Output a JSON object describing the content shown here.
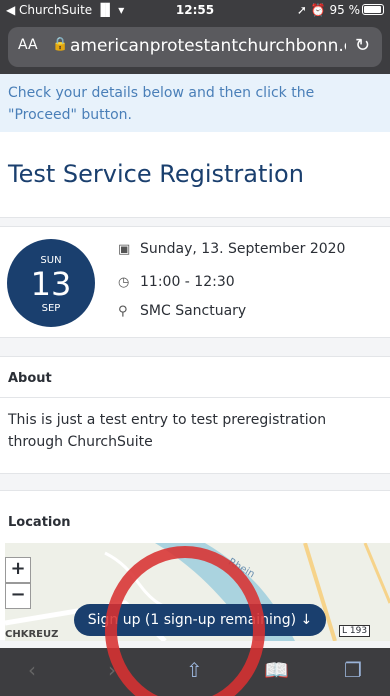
{
  "status": {
    "back_app": "◀ ChurchSuite",
    "signal": "▐▌ ▾",
    "time": "12:55",
    "battery": "95 %",
    "right_icons": "➚ ⏰"
  },
  "browser": {
    "aa": "AA",
    "url": "americanprotestantchurchbonn.church",
    "lock_icon": "lock-icon",
    "reload_icon": "reload-icon"
  },
  "banner": {
    "text": "Check your details below and then click the \"Proceed\" button."
  },
  "page": {
    "title": "Test Service Registration"
  },
  "event": {
    "dow": "SUN",
    "day": "13",
    "month": "SEP",
    "date": "Sunday, 13. September 2020",
    "time": "11:00 - 12:30",
    "location": "SMC Sanctuary"
  },
  "about": {
    "heading": "About",
    "text": "This is just a test entry to test preregistration through ChurchSuite"
  },
  "location": {
    "heading": "Location",
    "map_labels": [
      "CHKREUZ",
      "L 193",
      "Rhein"
    ]
  },
  "signup": {
    "label": "Sign up (1 sign-up remaining) ↓"
  },
  "colors": {
    "brand": "#1a3f6e",
    "banner_bg": "#e8f2fb",
    "banner_text": "#4a7fb8",
    "annotation": "#d83131"
  }
}
